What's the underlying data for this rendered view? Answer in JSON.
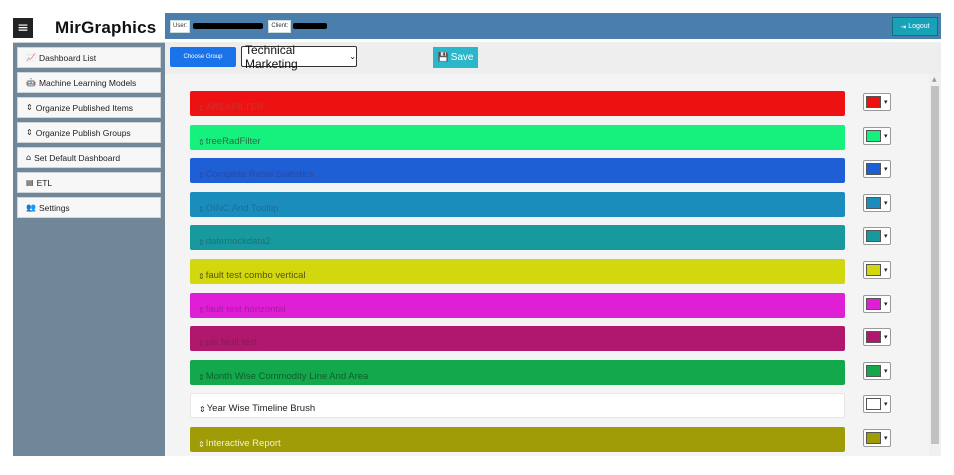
{
  "app": {
    "title": "MirGraphics",
    "hamburger_glyph": "≡"
  },
  "sidebar": {
    "items": [
      {
        "icon": "chart-line-icon",
        "glyph": "📈",
        "label": "Dashboard List"
      },
      {
        "icon": "robot-icon",
        "glyph": "🤖",
        "label": "Machine Learning Models"
      },
      {
        "icon": "sort-icon",
        "glyph": "⇕",
        "label": "Organize Published Items"
      },
      {
        "icon": "sort-icon",
        "glyph": "⇕",
        "label": "Organize Publish Groups"
      },
      {
        "icon": "home-icon",
        "glyph": "⌂",
        "label": "Set Default Dashboard"
      },
      {
        "icon": "file-icon",
        "glyph": "▤",
        "label": "ETL"
      },
      {
        "icon": "users-cog-icon",
        "glyph": "👥",
        "label": "Settings"
      }
    ]
  },
  "topbar": {
    "user_label": "User:",
    "client_label": "Client:",
    "logout_label": "Logout",
    "logout_glyph": "⇥"
  },
  "toolbar": {
    "choose_group_label": "Choose Group",
    "selected_group": "Technical Marketing",
    "select_caret": "⌄",
    "save_label": "Save",
    "save_glyph": "💾"
  },
  "items": [
    {
      "label": "AREAFILTER",
      "color": "#ee1111",
      "text_color": "#c23535"
    },
    {
      "label": "treeRadFilter",
      "color": "#16f07c",
      "text_color": "#2b6b46"
    },
    {
      "label": "Complete Retail Statistics",
      "color": "#1f5fd6",
      "text_color": "#2a49a4"
    },
    {
      "label": "OINC And Tooltip",
      "color": "#1a8dbd",
      "text_color": "#1a6f98"
    },
    {
      "label": "datemockdata2",
      "color": "#17999d",
      "text_color": "#1b7478"
    },
    {
      "label": "fault test combo vertical",
      "color": "#d2d80d",
      "text_color": "#555511"
    },
    {
      "label": "fault test horizontal",
      "color": "#e01ed6",
      "text_color": "#a0209a"
    },
    {
      "label": "pie fault test",
      "color": "#b0186e",
      "text_color": "#8a1a58"
    },
    {
      "label": "Month Wise Commodity Line And Area",
      "color": "#12a84b",
      "text_color": "#105f2f"
    },
    {
      "label": "Year Wise Timeline Brush",
      "color": "#ffffff",
      "text_color": "#222222"
    },
    {
      "label": "Interactive Report",
      "color": "#a09c07",
      "text_color": "#f2f2d0"
    }
  ],
  "glyphs": {
    "sort_handle": "⇕",
    "swatch_caret": "▾",
    "scroll_up": "▲"
  }
}
